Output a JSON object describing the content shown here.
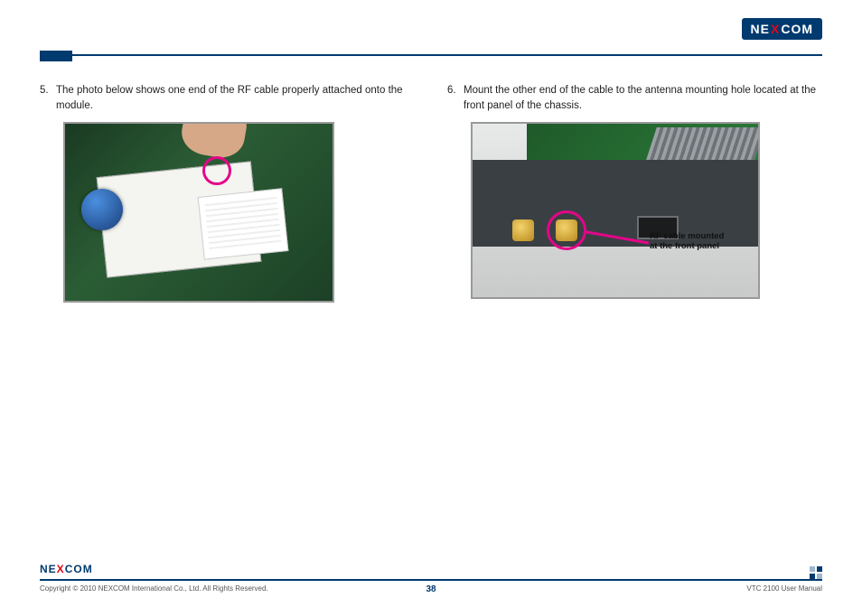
{
  "brand": "NEXCOM",
  "steps": {
    "s5": {
      "num": "5.",
      "text": "The photo below shows one end of the RF cable properly attached onto the module."
    },
    "s6": {
      "num": "6.",
      "text": "Mount the other end of the cable to the antenna mounting hole located at the front panel of the chassis."
    }
  },
  "callout": {
    "line1": "RF cable mounted",
    "line2": "at the front panel"
  },
  "footer": {
    "copyright": "Copyright © 2010 NEXCOM International Co., Ltd. All Rights Reserved.",
    "page": "38",
    "doc": "VTC 2100 User Manual"
  }
}
